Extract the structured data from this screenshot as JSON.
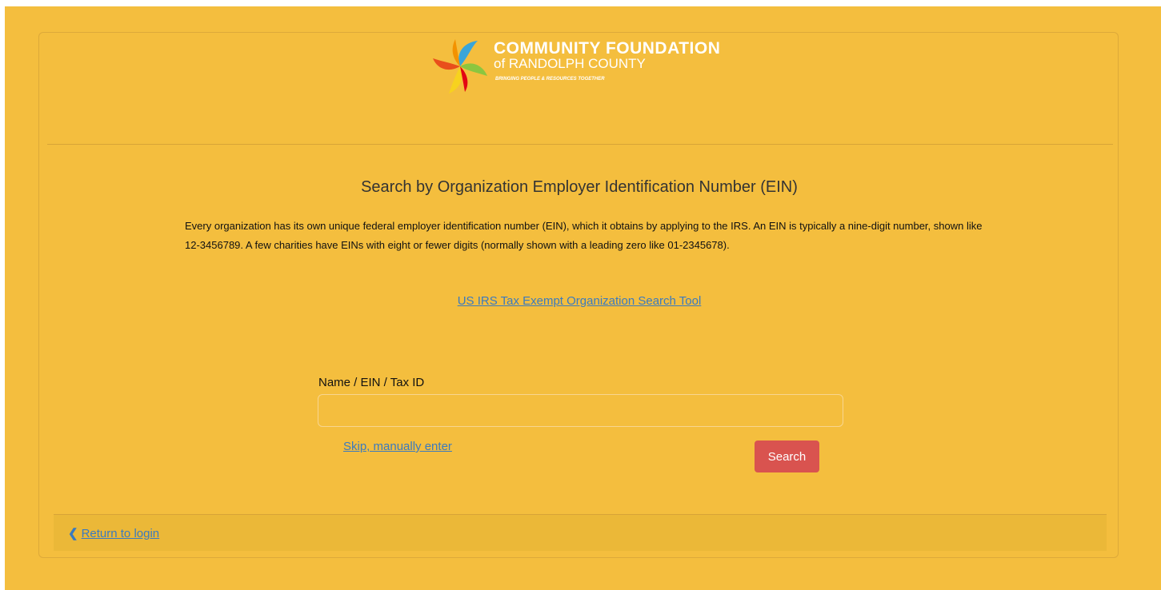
{
  "logo": {
    "title": "COMMUNITY FOUNDATION",
    "subtitle": "of RANDOLPH COUNTY",
    "tagline": "BRINGING PEOPLE & RESOURCES TOGETHER"
  },
  "main": {
    "heading": "Search by Organization Employer Identification Number (EIN)",
    "description": "Every organization has its own unique federal employer identification number (EIN), which it obtains by applying to the IRS. An EIN is typically a nine-digit number, shown like 12-3456789. A few charities have EINs with eight or fewer digits (normally shown with a leading zero like 01-2345678).",
    "irs_link": "US IRS Tax Exempt Organization Search Tool"
  },
  "form": {
    "label": "Name / EIN / Tax ID",
    "value": "",
    "placeholder": "",
    "skip_label": "Skip, manually enter",
    "search_label": "Search"
  },
  "footer": {
    "return_label": "Return to login",
    "chevron_icon": "chevron-left-icon"
  },
  "colors": {
    "background": "#f4be3e",
    "link": "#3a7abf",
    "button": "#d9534f"
  }
}
